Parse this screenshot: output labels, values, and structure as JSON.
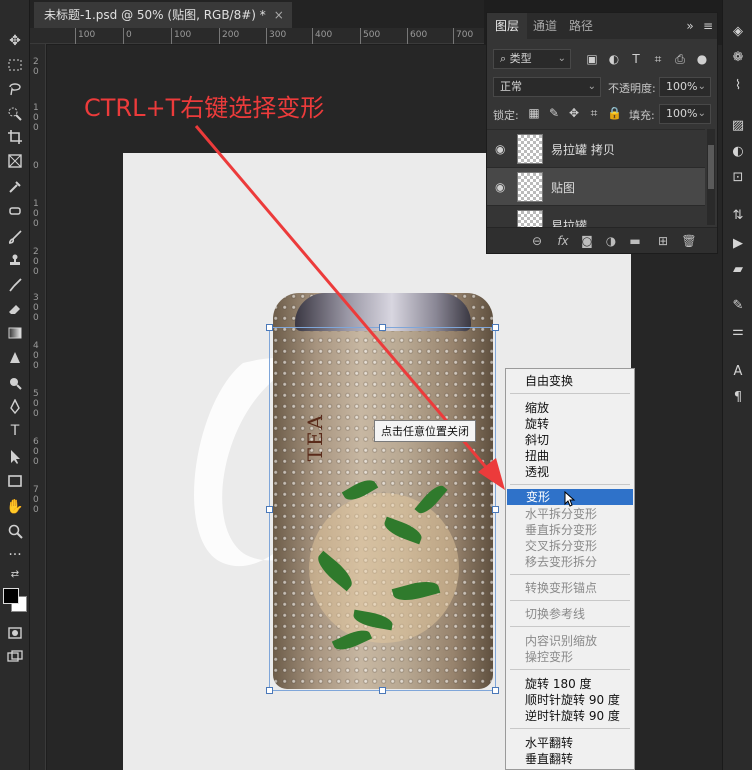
{
  "document": {
    "tab_title": "未标题-1.psd @ 50% (贴图, RGB/8#) *",
    "close_glyph": "×",
    "ruler_top_marks": [
      "100",
      "0",
      "100",
      "200",
      "300",
      "400",
      "500",
      "600",
      "700"
    ],
    "ruler_left_marks": [
      "2",
      "0",
      "1",
      "0",
      "0",
      "0",
      "1",
      "0",
      "0",
      "2",
      "0",
      "0",
      "3",
      "0",
      "0",
      "4",
      "0",
      "0",
      "5",
      "0",
      "0",
      "6",
      "0",
      "0",
      "7",
      "0",
      "0"
    ]
  },
  "annotation": {
    "text": "CTRL+T右键选择变形",
    "color": "#ec3b3b"
  },
  "can": {
    "label_text": "TEA"
  },
  "tooltip": {
    "text": "点击任意位置关闭"
  },
  "context_menu": {
    "items": [
      {
        "label": "自由变换",
        "state": "normal"
      },
      {
        "label": "缩放",
        "state": "normal"
      },
      {
        "label": "旋转",
        "state": "normal"
      },
      {
        "label": "斜切",
        "state": "normal"
      },
      {
        "label": "扭曲",
        "state": "normal"
      },
      {
        "label": "透视",
        "state": "normal"
      },
      {
        "label": "变形",
        "state": "selected"
      },
      {
        "label": "水平拆分变形",
        "state": "disabled"
      },
      {
        "label": "垂直拆分变形",
        "state": "disabled"
      },
      {
        "label": "交叉拆分变形",
        "state": "disabled"
      },
      {
        "label": "移去变形拆分",
        "state": "disabled"
      },
      {
        "label": "转换变形锚点",
        "state": "disabled"
      },
      {
        "label": "切换参考线",
        "state": "disabled"
      },
      {
        "label": "内容识别缩放",
        "state": "disabled"
      },
      {
        "label": "操控变形",
        "state": "disabled"
      },
      {
        "label": "旋转 180 度",
        "state": "normal"
      },
      {
        "label": "顺时针旋转 90 度",
        "state": "normal"
      },
      {
        "label": "逆时针旋转 90 度",
        "state": "normal"
      },
      {
        "label": "水平翻转",
        "state": "normal"
      },
      {
        "label": "垂直翻转",
        "state": "normal"
      }
    ],
    "selected_color": "#2f72c9"
  },
  "layers_panel": {
    "tabs": [
      "图层",
      "通道",
      "路径"
    ],
    "active_tab": "图层",
    "filter_label": "类型",
    "blend_mode": "正常",
    "opacity_label": "不透明度:",
    "opacity_value": "100%",
    "lock_label": "锁定:",
    "fill_label": "填充:",
    "fill_value": "100%",
    "layers": [
      {
        "name": "易拉罐 拷贝",
        "selected": false
      },
      {
        "name": "贴图",
        "selected": true
      },
      {
        "name": "易拉罐",
        "selected": false
      }
    ],
    "bottom_icons": [
      "link-icon",
      "fx-icon",
      "mask-icon",
      "adjustment-icon",
      "folder-icon",
      "new-layer-icon",
      "trash-icon"
    ],
    "fx_label": "fx"
  }
}
